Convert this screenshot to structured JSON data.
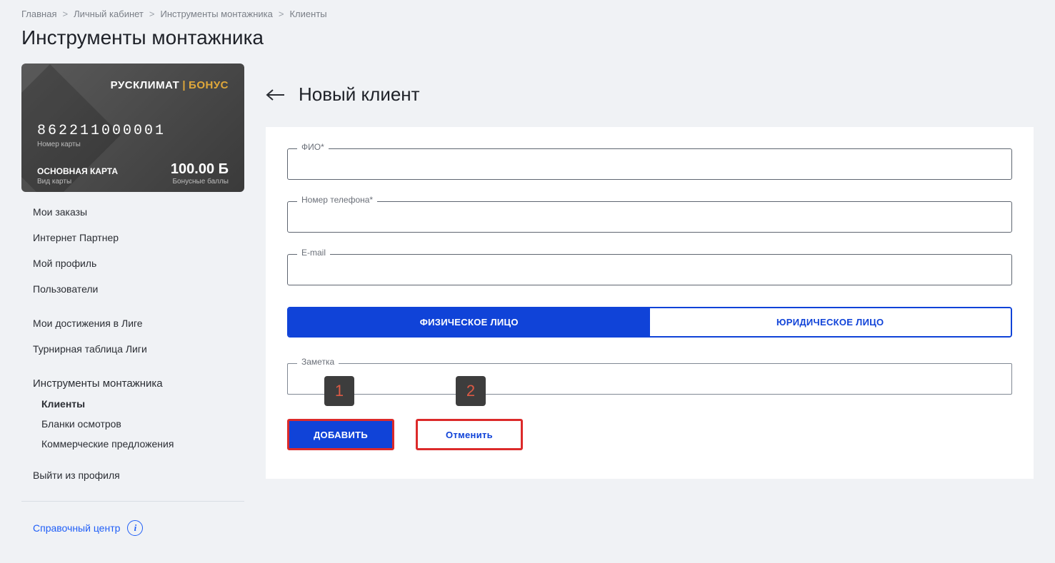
{
  "breadcrumb": [
    {
      "label": "Главная"
    },
    {
      "label": "Личный кабинет"
    },
    {
      "label": "Инструменты монтажника"
    },
    {
      "label": "Клиенты"
    }
  ],
  "page_title": "Инструменты монтажника",
  "card": {
    "brand_main": "РУСКЛИМАТ",
    "brand_suffix": "БОНУС",
    "number": "862211000001",
    "number_label": "Номер карты",
    "type": "ОСНОВНАЯ КАРТА",
    "type_label": "Вид карты",
    "points": "100.00 Б",
    "points_label": "Бонусные баллы"
  },
  "sidebar": {
    "items": [
      "Мои заказы",
      "Интернет Партнер",
      "Мой профиль",
      "Пользователи"
    ],
    "items2": [
      "Мои достижения в Лиге",
      "Турнирная таблица Лиги"
    ],
    "group": {
      "title": "Инструменты монтажника",
      "children": [
        "Клиенты",
        "Бланки осмотров",
        "Коммерческие предложения"
      ]
    },
    "logout": "Выйти из профиля",
    "help": "Справочный центр"
  },
  "main": {
    "title": "Новый клиент",
    "fields": {
      "fio": "ФИО*",
      "phone": "Номер телефона*",
      "email": "E-mail",
      "note": "Заметка"
    },
    "tabs": {
      "individual": "ФИЗИЧЕСКОЕ ЛИЦО",
      "legal": "ЮРИДИЧЕСКОЕ ЛИЦО"
    },
    "buttons": {
      "add": "ДОБАВИТЬ",
      "cancel": "Отменить"
    },
    "callouts": {
      "one": "1",
      "two": "2"
    }
  }
}
